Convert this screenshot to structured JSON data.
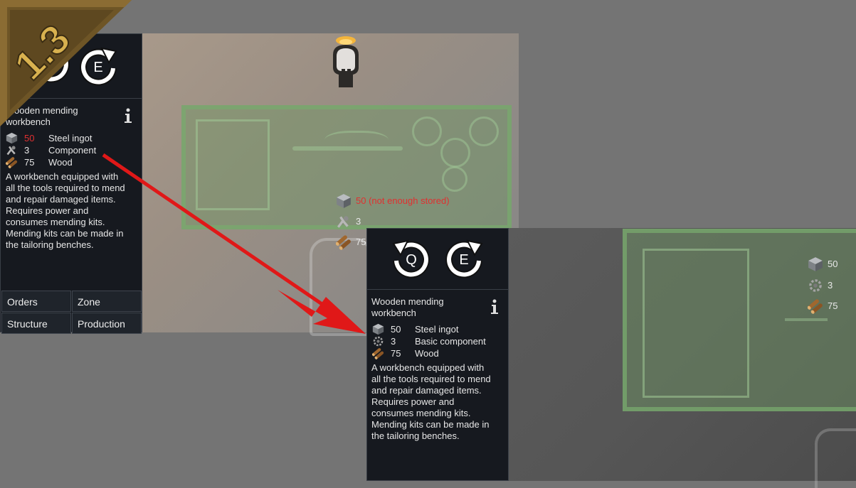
{
  "version_badge": "1.3",
  "colors": {
    "accent_red": "#e02020",
    "panel_bg": "#16191f",
    "footprint_green": "#7aaa6e",
    "insufficient_red": "#e03030",
    "badge_gold": "#c9a04a"
  },
  "old": {
    "rotate_cw_key": "E",
    "title": "Wooden mending workbench",
    "costs": [
      {
        "amount": "50",
        "name": "Steel ingot",
        "icon": "steel-ingot-icon",
        "insufficient": true
      },
      {
        "amount": "3",
        "name": "Component",
        "icon": "component-icon",
        "insufficient": false
      },
      {
        "amount": "75",
        "name": "Wood",
        "icon": "wood-icon",
        "insufficient": false
      }
    ],
    "description": [
      "A workbench equipped with",
      "all the tools required to mend",
      "and repair damaged items.",
      "Requires power and",
      "consumes mending kits.",
      "Mending kits can be made in",
      "the tailoring benches."
    ],
    "tabs": [
      "Orders",
      "Zone",
      "Structure",
      "Production"
    ],
    "float_costs": [
      "50 (not enough stored)",
      "3",
      "75"
    ]
  },
  "new": {
    "rotate_ccw_key": "Q",
    "rotate_cw_key": "E",
    "title": "Wooden mending workbench",
    "costs": [
      {
        "amount": "50",
        "name": "Steel ingot",
        "icon": "steel-ingot-icon"
      },
      {
        "amount": "3",
        "name": "Basic component",
        "icon": "basic-component-icon"
      },
      {
        "amount": "75",
        "name": "Wood",
        "icon": "wood-icon"
      }
    ],
    "description": [
      "A workbench equipped with",
      "all the tools required to mend",
      "and repair damaged items.",
      "Requires power and",
      "consumes mending kits.",
      "Mending kits can be made in",
      "the tailoring benches."
    ],
    "float_costs": [
      "50",
      "3",
      "75"
    ]
  }
}
